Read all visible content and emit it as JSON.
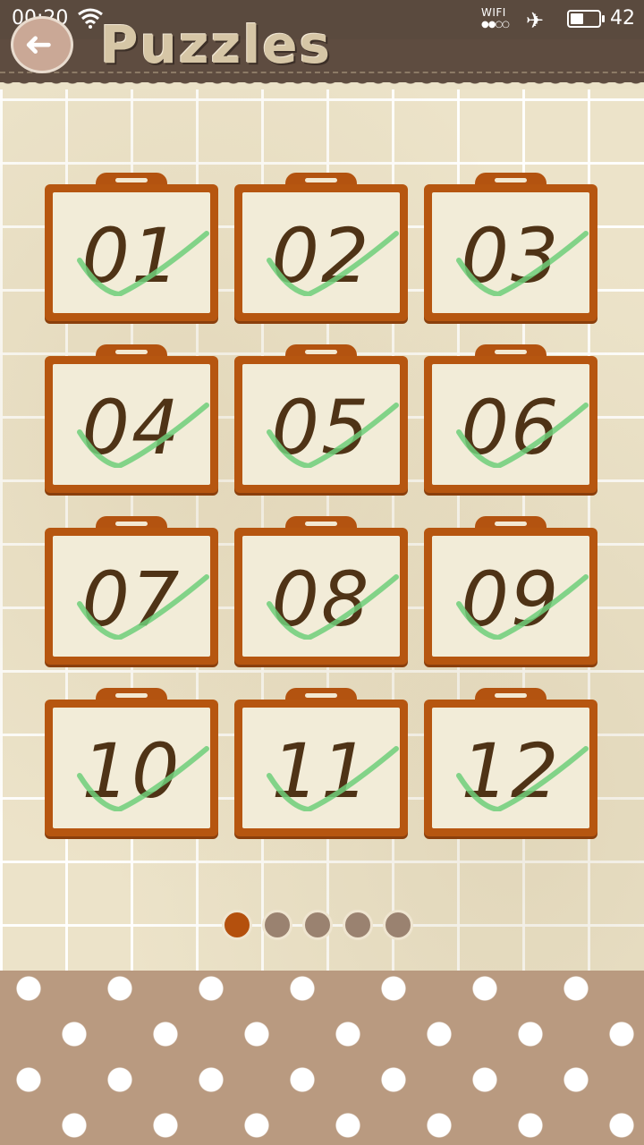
{
  "status_bar": {
    "time": "00:20",
    "wifi_label": "WIFI",
    "wifi_dots": "●●○○",
    "battery_level": "42"
  },
  "header": {
    "back_arrow": "➜",
    "title": "Puzzles"
  },
  "puzzles": [
    {
      "number": "01",
      "completed": true
    },
    {
      "number": "02",
      "completed": true
    },
    {
      "number": "03",
      "completed": true
    },
    {
      "number": "04",
      "completed": true
    },
    {
      "number": "05",
      "completed": true
    },
    {
      "number": "06",
      "completed": true
    },
    {
      "number": "07",
      "completed": true
    },
    {
      "number": "08",
      "completed": true
    },
    {
      "number": "09",
      "completed": true
    },
    {
      "number": "10",
      "completed": true
    },
    {
      "number": "11",
      "completed": true
    },
    {
      "number": "12",
      "completed": true
    }
  ],
  "pager": {
    "page_count": 5,
    "active_page": 1
  },
  "colors": {
    "header": "#5e4c40",
    "tile_frame": "#b65610",
    "number_ink": "#4f3316",
    "check": "#6fcf7a",
    "active_dot": "#b4500d",
    "inactive_dot": "#9a8270"
  },
  "icons": {
    "back": "back-arrow-icon",
    "check": "check-mark-icon",
    "wifi": "wifi-icon",
    "airplane": "airplane-mode-icon",
    "battery": "battery-icon"
  }
}
